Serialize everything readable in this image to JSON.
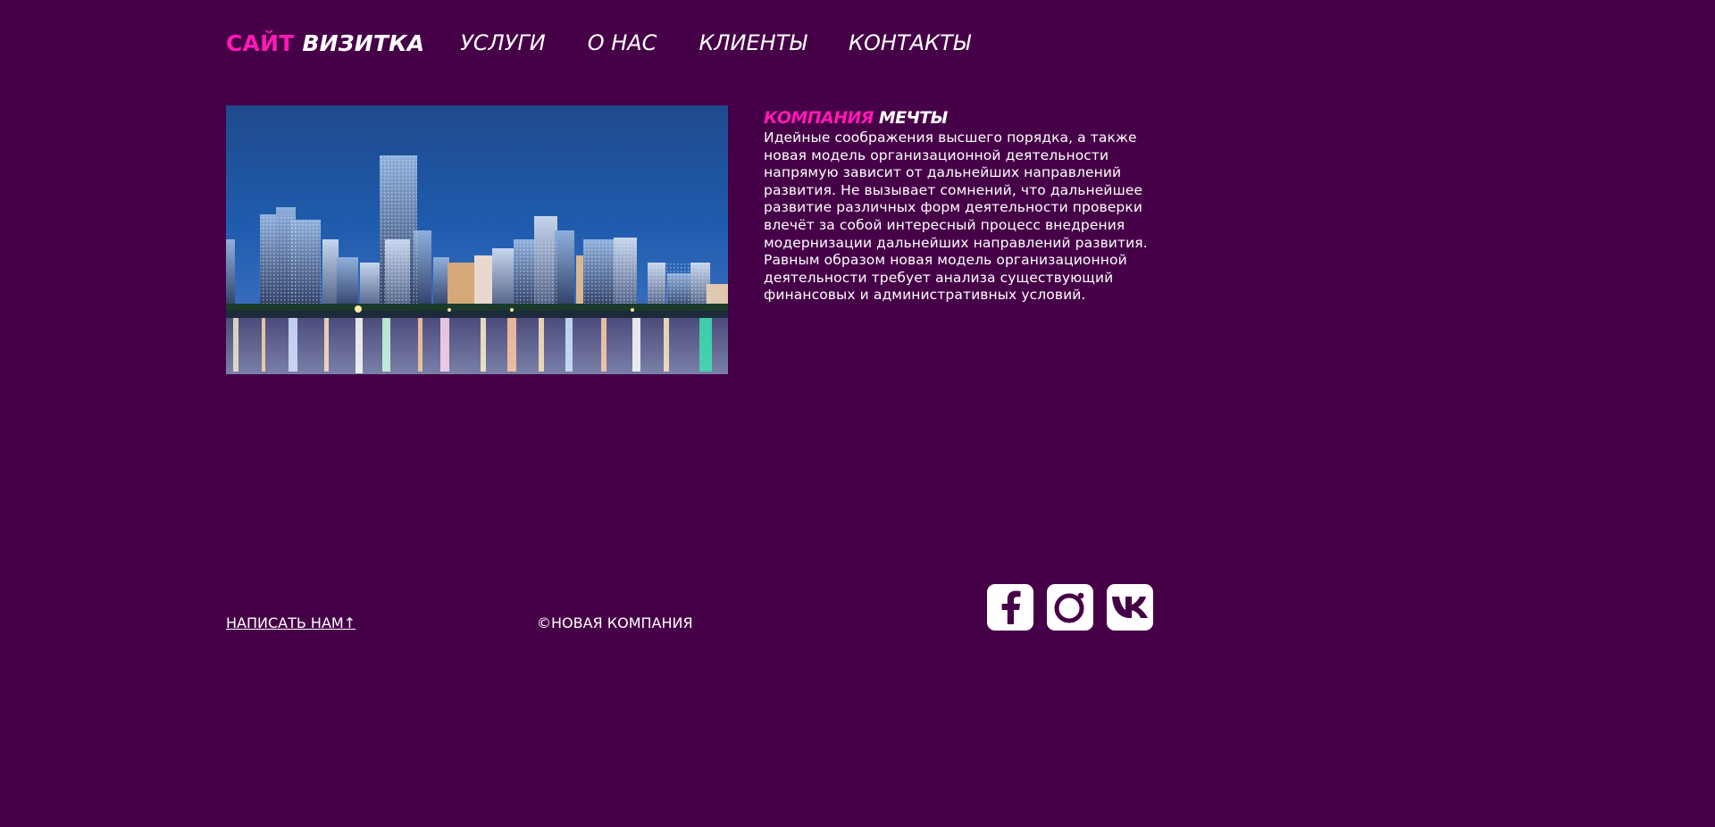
{
  "header": {
    "logo_accent": "САЙТ",
    "logo_main": "ВИЗИТКА",
    "nav": [
      {
        "label": "УСЛУГИ"
      },
      {
        "label": "О НАС"
      },
      {
        "label": "КЛИЕНТЫ"
      },
      {
        "label": "КОНТАКТЫ"
      }
    ]
  },
  "about": {
    "title_accent": "КОМПАНИЯ",
    "title_main": "МЕЧТЫ",
    "text": "Идейные соображения высшего порядка, а также новая модель организационной деятельности напрямую зависит от дальнейших направлений развития. Не вызывает сомнений, что дальнейшее развитие различных форм деятельности проверки влечёт за собой интересный процесс внедрения модернизации дальнейших направлений развития. Равным образом новая модель организационной деятельности требует анализа существующий финансовых и административных условий."
  },
  "footer": {
    "write_us": "НАПИСАТЬ НАМ↑",
    "copyright": "©НОВАЯ КОМПАНИЯ",
    "socials": [
      {
        "icon": "facebook-icon"
      },
      {
        "icon": "instagram-icon"
      },
      {
        "icon": "vk-icon"
      }
    ]
  },
  "colors": {
    "background": "#460047",
    "accent": "#ff19b5",
    "text": "#ffffff"
  }
}
